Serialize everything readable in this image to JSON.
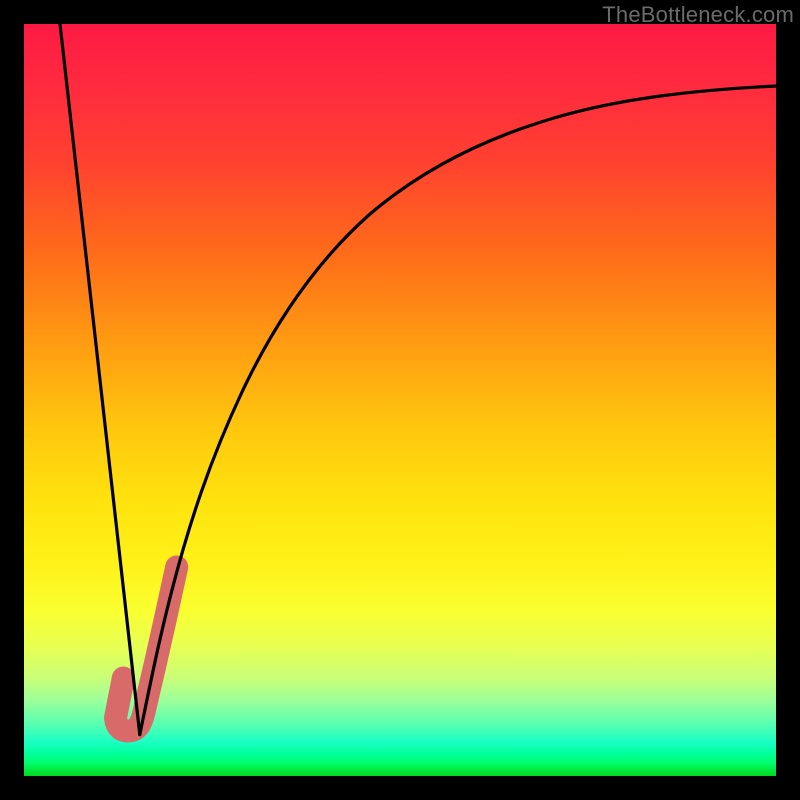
{
  "watermark": "TheBottleneck.com",
  "colors": {
    "bg": "#000000",
    "curve": "#000000",
    "marker": "#d96a6a",
    "grad_top": "#ff1a44",
    "grad_mid": "#fff21a",
    "grad_bot": "#00d820"
  },
  "chart_data": {
    "type": "line",
    "title": "",
    "xlabel": "",
    "ylabel": "",
    "xlim": [
      0,
      100
    ],
    "ylim": [
      0,
      100
    ],
    "series": [
      {
        "name": "left-line",
        "x": [
          4.8,
          15.4
        ],
        "values": [
          100,
          5.5
        ]
      },
      {
        "name": "right-curve",
        "x": [
          15.4,
          17,
          19,
          21,
          24,
          28,
          33,
          39,
          46,
          54,
          63,
          73,
          84,
          96,
          100
        ],
        "values": [
          5.5,
          13,
          22,
          31,
          42,
          53,
          62.5,
          71,
          77.3,
          82,
          85.3,
          87.9,
          89.7,
          91.2,
          91.7
        ]
      },
      {
        "name": "marker-j",
        "x": [
          15.4,
          17,
          19,
          20.3,
          20.3,
          19.5,
          18.6,
          16.9,
          15.2
        ],
        "values": [
          5.5,
          13,
          22,
          27.8,
          27.8,
          23.5,
          19.2,
          10.6,
          6.4
        ]
      }
    ],
    "notes": "Axes are unitless; the plot area spans the inner 752x752 square inside a 24px black border. Values expressed as percentages of plot range. The left-line descends linearly from top-left to the vertex near (15.4, 5.5). The right-curve rises with decreasing slope toward ~92% on the right edge. marker-j is a thick salmon stroke hugging the lower portion of the right-curve then hooking left/down to the vertex."
  }
}
